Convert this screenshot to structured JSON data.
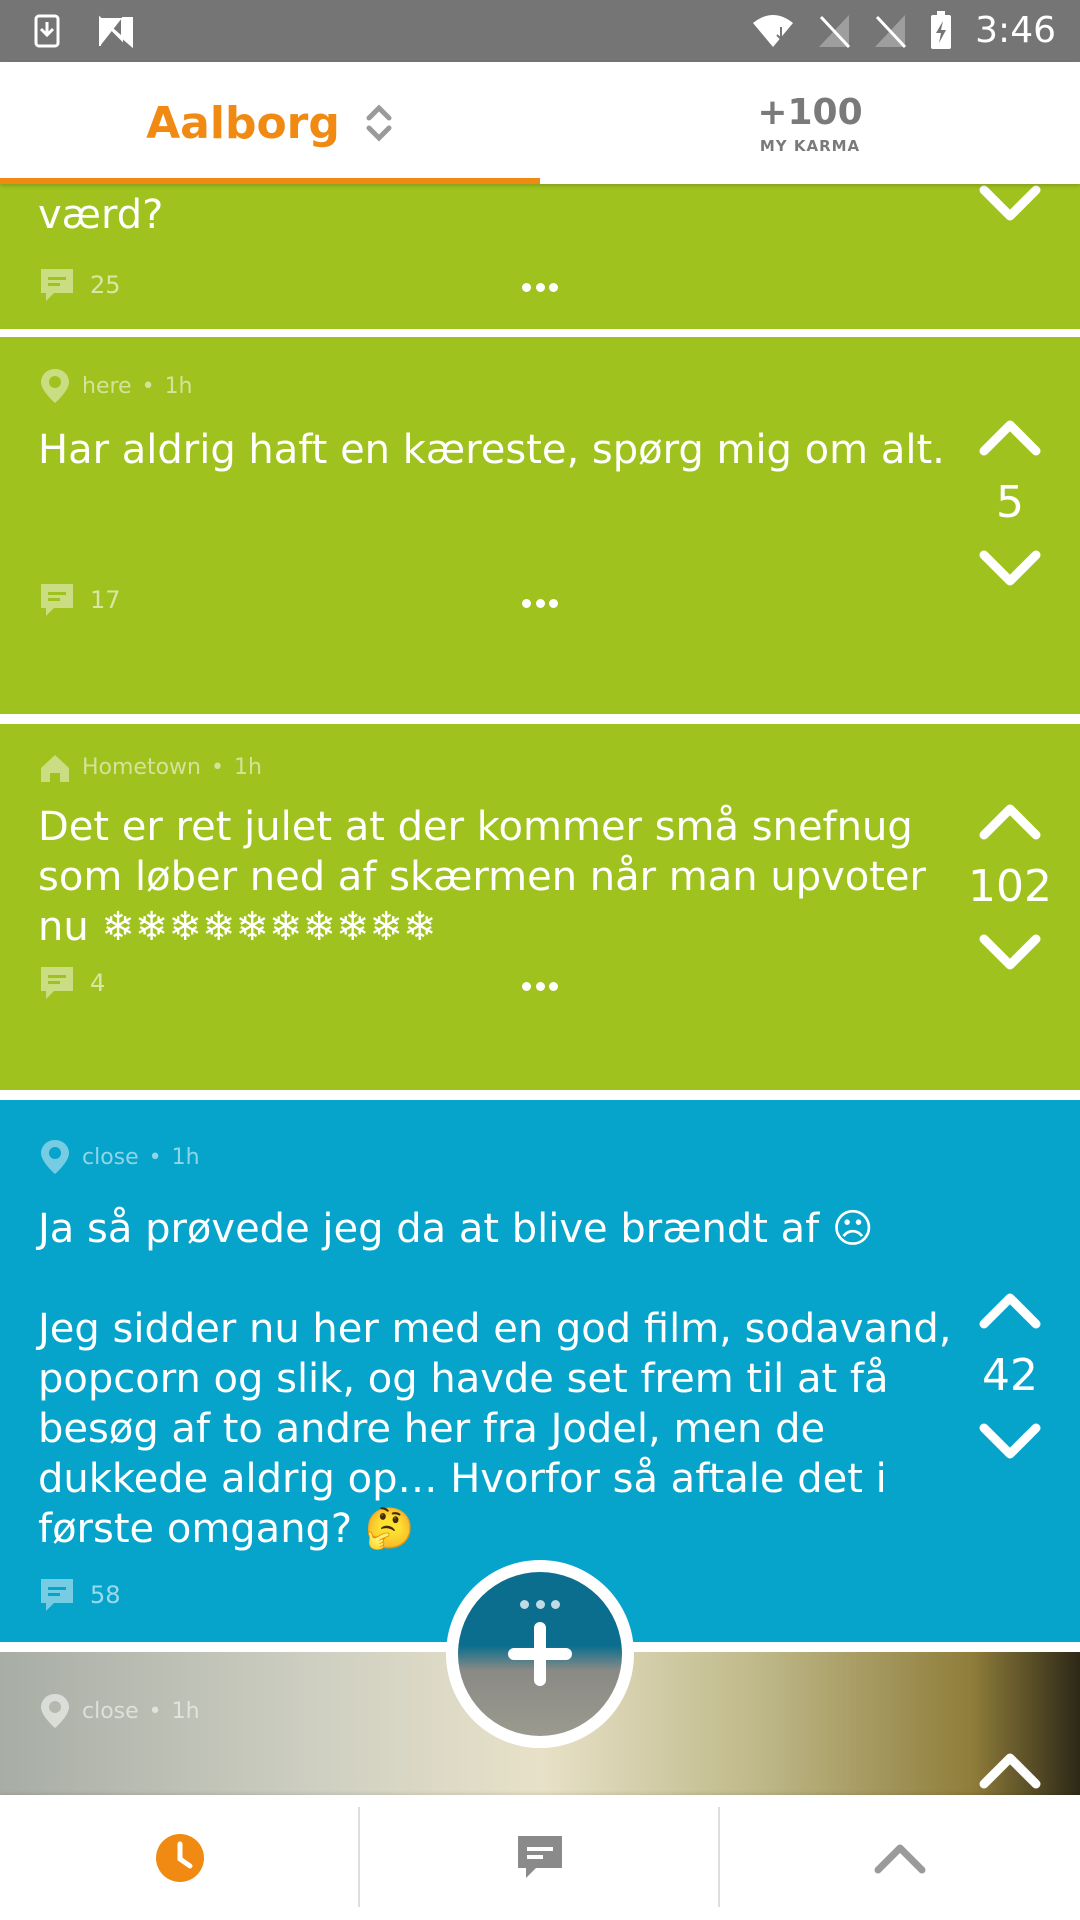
{
  "status_bar": {
    "time": "3:46",
    "icons": [
      "download-icon",
      "n-logo-icon",
      "wifi-icon",
      "no-signal-icon",
      "no-sim-icon",
      "battery-charging-icon"
    ]
  },
  "header": {
    "location": "Aalborg",
    "location_icon": "chevron-up-down-icon",
    "karma_value": "+100",
    "karma_label": "MY KARMA",
    "accent_color": "#f08a12"
  },
  "posts": [
    {
      "color": "green",
      "text": "værd?",
      "comments": "25"
    },
    {
      "color": "green",
      "location": "here",
      "time": "1h",
      "meta_icon": "location-pin-icon",
      "text": "Har aldrig haft en kæreste, spørg mig om alt.",
      "votes": "5",
      "comments": "17"
    },
    {
      "color": "green",
      "location": "Hometown",
      "time": "1h",
      "meta_icon": "home-icon",
      "text": "Det er ret julet at der kommer små snefnug som løber ned af skærmen når man upvoter nu ❄❄❄❄❄❄❄❄❄❄",
      "votes": "102",
      "comments": "4"
    },
    {
      "color": "blue",
      "location": "close",
      "time": "1h",
      "meta_icon": "location-pin-icon",
      "text": "Ja så prøvede jeg da at blive brændt af ☹\n\nJeg sidder nu her med en god film, sodavand, popcorn og slik, og havde set frem til at få besøg af to andre her fra Jodel, men de dukkede aldrig op… Hvorfor så aftale det i første omgang? 🤔",
      "votes": "42",
      "comments": "58"
    },
    {
      "color": "gradient",
      "location": "close",
      "time": "1h",
      "meta_icon": "location-pin-icon"
    }
  ],
  "colors": {
    "green": "#a0c21e",
    "blue": "#06a3cb",
    "orange": "#f08a12"
  },
  "bottom_nav": {
    "items": [
      "clock-icon",
      "chat-icon",
      "chevron-up-icon"
    ]
  },
  "fab_icon": "plus-icon",
  "separator": "•"
}
